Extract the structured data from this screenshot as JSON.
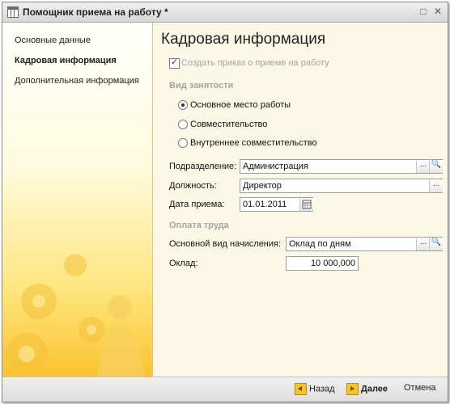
{
  "window": {
    "title": "Помощник приема на работу *"
  },
  "titlebar": {
    "maximize_glyph": "□",
    "close_glyph": "✕"
  },
  "sidebar": {
    "items": [
      {
        "label": "Основные данные",
        "active": false
      },
      {
        "label": "Кадровая информация",
        "active": true
      },
      {
        "label": "Дополнительная информация",
        "active": false
      }
    ]
  },
  "main": {
    "heading": "Кадровая информация",
    "create_order": {
      "label": "Создать приказ о приеме на работу",
      "checked": true
    },
    "employment_type": {
      "group_label": "Вид занятости",
      "options": [
        {
          "label": "Основное место работы",
          "selected": true
        },
        {
          "label": "Совместительство",
          "selected": false
        },
        {
          "label": "Внутреннее совместительство",
          "selected": false
        }
      ]
    },
    "department": {
      "label": "Подразделение:",
      "value": "Администрация"
    },
    "position": {
      "label": "Должность:",
      "value": "Директор"
    },
    "hire_date": {
      "label": "Дата приема:",
      "value": "01.01.2011"
    },
    "payment": {
      "group_label": "Оплата труда",
      "accrual_type": {
        "label": "Основной вид начисления:",
        "value": "Оклад по дням"
      },
      "salary": {
        "label": "Оклад:",
        "value": "10 000,000"
      }
    },
    "select_glyph": "...",
    "search_glyph": "🔍"
  },
  "footer": {
    "back_label": "Назад",
    "next_label": "Далее",
    "cancel_label": "Отмена"
  },
  "colors": {
    "accent_yellow": "#f2c52b",
    "sidebar_gradient_bottom": "#fbc430",
    "group_label_gray": "#a3a3a3"
  }
}
